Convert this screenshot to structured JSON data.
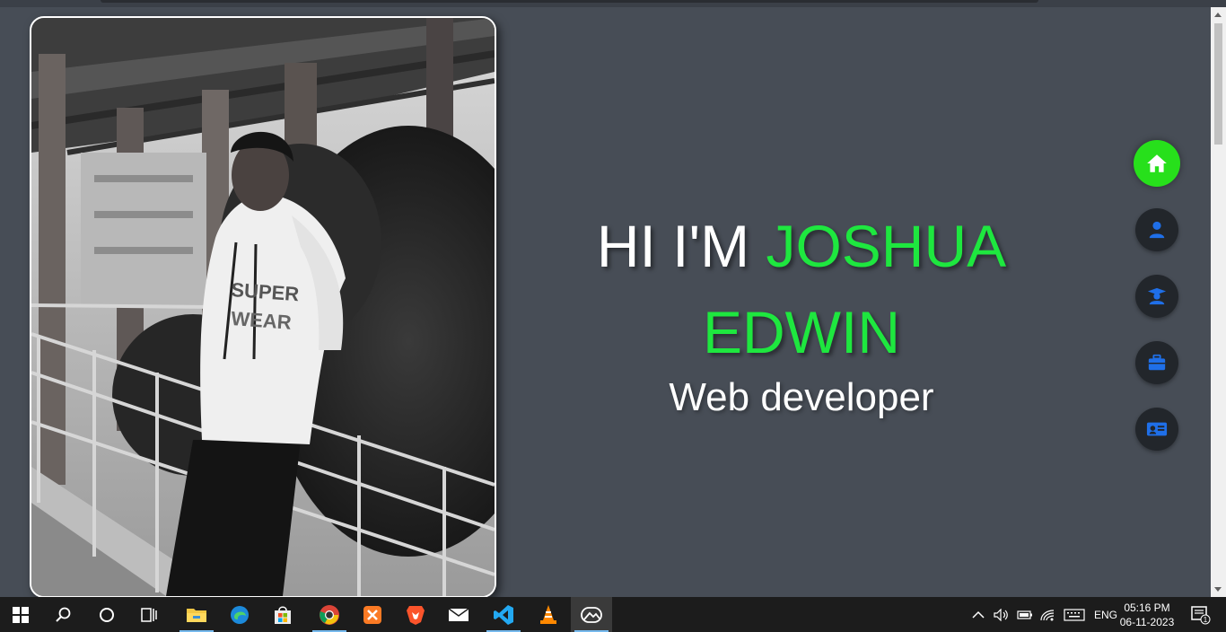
{
  "hero": {
    "greeting": "HI I'M",
    "name_line1": "JOSHUA",
    "name_line2": "EDWIN",
    "role": "Web developer"
  },
  "photo": {
    "icon": "portrait-photo"
  },
  "nav": [
    {
      "name": "home",
      "icon": "home-icon",
      "active": true
    },
    {
      "name": "about",
      "icon": "user-icon",
      "active": false
    },
    {
      "name": "education",
      "icon": "graduate-icon",
      "active": false
    },
    {
      "name": "portfolio",
      "icon": "briefcase-icon",
      "active": false
    },
    {
      "name": "contact",
      "icon": "contact-card-icon",
      "active": false
    }
  ],
  "colors": {
    "background": "#474d56",
    "accent": "#1ee73f",
    "nav_active": "#27e01b",
    "nav_inactive": "#22262b",
    "nav_icon": "#1f6fe8"
  },
  "taskbar": {
    "apps": [
      "windows-start",
      "search",
      "cortana",
      "task-view",
      "file-explorer",
      "edge",
      "store",
      "chrome",
      "xampp",
      "brave",
      "mail",
      "vscode",
      "vlc",
      "photos"
    ],
    "language": "ENG",
    "time": "05:16 PM",
    "date": "06-11-2023",
    "notification_count": "1"
  }
}
